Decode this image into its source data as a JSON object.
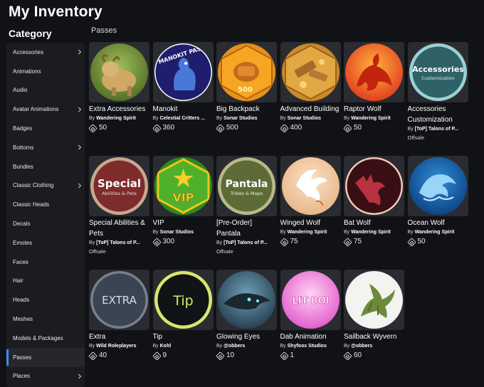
{
  "page": {
    "title": "My Inventory"
  },
  "sidebar": {
    "heading": "Category",
    "active": "Passes",
    "items": [
      {
        "label": "Accessories",
        "has_submenu": true
      },
      {
        "label": "Animations",
        "has_submenu": false
      },
      {
        "label": "Audio",
        "has_submenu": false
      },
      {
        "label": "Avatar Animations",
        "has_submenu": true
      },
      {
        "label": "Badges",
        "has_submenu": false
      },
      {
        "label": "Bottoms",
        "has_submenu": true
      },
      {
        "label": "Bundles",
        "has_submenu": false
      },
      {
        "label": "Classic Clothing",
        "has_submenu": true
      },
      {
        "label": "Classic Heads",
        "has_submenu": false
      },
      {
        "label": "Decals",
        "has_submenu": false
      },
      {
        "label": "Emotes",
        "has_submenu": false
      },
      {
        "label": "Faces",
        "has_submenu": false
      },
      {
        "label": "Hair",
        "has_submenu": false
      },
      {
        "label": "Heads",
        "has_submenu": false
      },
      {
        "label": "Meshes",
        "has_submenu": false
      },
      {
        "label": "Models & Packages",
        "has_submenu": false
      },
      {
        "label": "Passes",
        "has_submenu": false
      },
      {
        "label": "Places",
        "has_submenu": true
      }
    ]
  },
  "section": {
    "label": "Passes"
  },
  "creator_prefix": "By ",
  "items": [
    {
      "name": "Extra Accessories",
      "creator": "Wandering Spirit",
      "price": "50",
      "icon": "extra-accessories-icon"
    },
    {
      "name": "Manokit",
      "creator": "Celestial Critters ...",
      "price": "360",
      "icon": "manokit-icon",
      "disc_text": "MANOKIT PASS!"
    },
    {
      "name": "Big Backpack",
      "creator": "Sonar Studios",
      "price": "500",
      "icon": "big-backpack-icon",
      "disc_text": "500"
    },
    {
      "name": "Advanced Building",
      "creator": "Sonar Studios",
      "price": "400",
      "icon": "advanced-building-icon"
    },
    {
      "name": "Raptor Wolf",
      "creator": "Wandering Spirit",
      "price": "50",
      "icon": "raptor-wolf-icon"
    },
    {
      "name": "Accessories Customization",
      "creator": "[ToP] Talons of P...",
      "status": "Offsale",
      "icon": "accessories-customization-icon",
      "disc_text": "Accessories",
      "disc_subtext": "Customization"
    },
    {
      "name": "Special Abilities & Pets",
      "creator": "[ToP] Talons of P...",
      "status": "Offsale",
      "icon": "special-abilities-icon",
      "disc_text": "Special",
      "disc_subtext": "Abilities & Pets"
    },
    {
      "name": "VIP",
      "creator": "Sonar Studios",
      "price": "300",
      "icon": "vip-icon",
      "disc_text": "VIP"
    },
    {
      "name": "[Pre-Order] Pantala",
      "creator": "[ToP] Talons of P...",
      "status": "Offsale",
      "icon": "pantala-icon",
      "disc_text": "Pantala",
      "disc_subtext": "Tribes & Maps"
    },
    {
      "name": "Winged Wolf",
      "creator": "Wandering Spirit",
      "price": "75",
      "icon": "winged-wolf-icon"
    },
    {
      "name": "Bat Wolf",
      "creator": "Wandering Spirit",
      "price": "75",
      "icon": "bat-wolf-icon"
    },
    {
      "name": "Ocean Wolf",
      "creator": "Wandering Spirit",
      "price": "50",
      "icon": "ocean-wolf-icon"
    },
    {
      "name": "Extra",
      "creator": "Wild Roleplayers",
      "price": "40",
      "icon": "extra-icon",
      "disc_text": "EXTRA"
    },
    {
      "name": "Tip",
      "creator": "Kohl",
      "price": "9",
      "icon": "tip-icon",
      "disc_text": "Tip"
    },
    {
      "name": "Glowing Eyes",
      "creator": "@obbers",
      "price": "10",
      "icon": "glowing-eyes-icon"
    },
    {
      "name": "Dab Animation",
      "creator": "Shyfoox Studios",
      "price": "1",
      "icon": "dab-animation-icon",
      "disc_text": "LIT BOI"
    },
    {
      "name": "Sailback Wyvern",
      "creator": "@obbers",
      "price": "60",
      "icon": "sailback-wyvern-icon"
    }
  ]
}
